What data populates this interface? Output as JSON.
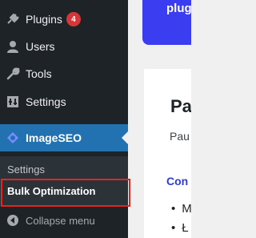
{
  "sidebar": {
    "items": [
      {
        "label": "Plugins",
        "icon": "plugin-icon",
        "badge": "4"
      },
      {
        "label": "Users",
        "icon": "users-icon"
      },
      {
        "label": "Tools",
        "icon": "wrench-icon"
      },
      {
        "label": "Settings",
        "icon": "settings-icon"
      },
      {
        "label": "ImageSEO",
        "icon": "imageseo-icon"
      }
    ],
    "submenu": {
      "settings": "Settings",
      "bulk": "Bulk Optimization"
    },
    "collapse": "Collapse menu"
  },
  "main": {
    "banner": "plug",
    "card_title": "Pa",
    "card_sub": "Pau",
    "card_head": "Con",
    "bullets": [
      "M",
      "Ł"
    ]
  },
  "colors": {
    "sidebar": "#1d2327",
    "active": "#2271b1",
    "highlight": "#e4251e",
    "banner": "#3b3df0"
  }
}
